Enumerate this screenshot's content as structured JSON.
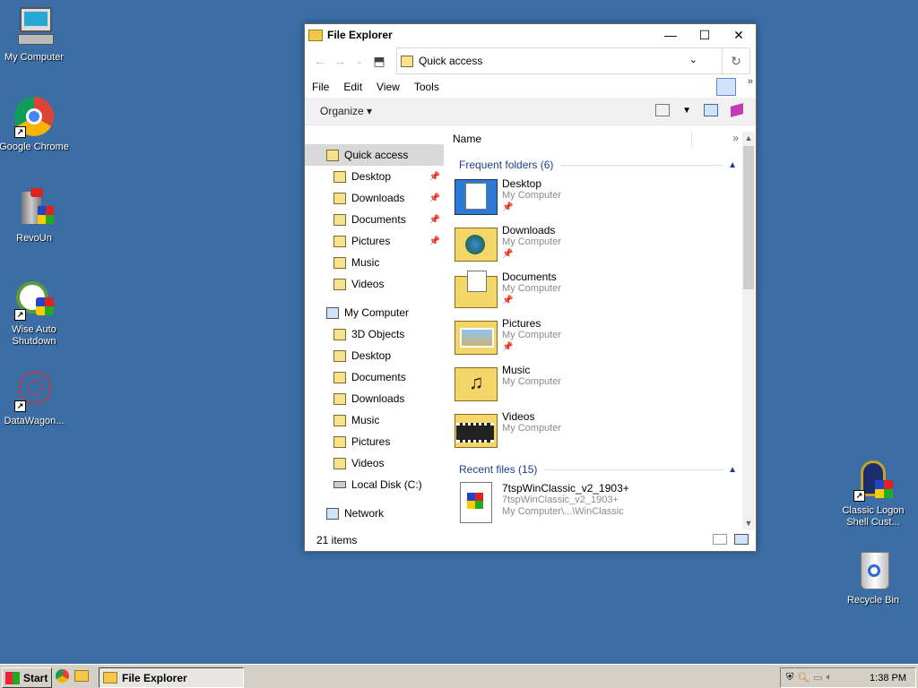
{
  "desktop": {
    "icons": [
      {
        "label": "My Computer",
        "icon": "computer-icon"
      },
      {
        "label": "Google Chrome",
        "icon": "chrome-icon"
      },
      {
        "label": "RevoUn",
        "icon": "revo-uninstaller-icon"
      },
      {
        "label": "Wise Auto Shutdown",
        "icon": "alarm-clock-icon"
      },
      {
        "label": "DataWagon...",
        "icon": "datawagon-icon"
      },
      {
        "label": "Classic Logon Shell Cust...",
        "icon": "logon-shell-icon"
      },
      {
        "label": "Recycle Bin",
        "icon": "recycle-bin-icon"
      }
    ]
  },
  "window": {
    "title": "File Explorer",
    "address": "Quick access",
    "menu": [
      "File",
      "Edit",
      "View",
      "Tools"
    ],
    "organize_label": "Organize",
    "column_name": "Name",
    "status": "21 items"
  },
  "navpane": {
    "quick_access": "Quick access",
    "quick_items": [
      "Desktop",
      "Downloads",
      "Documents",
      "Pictures",
      "Music",
      "Videos"
    ],
    "my_computer": "My Computer",
    "computer_items": [
      "3D Objects",
      "Desktop",
      "Documents",
      "Downloads",
      "Music",
      "Pictures",
      "Videos",
      "Local Disk (C:)"
    ],
    "network": "Network"
  },
  "content": {
    "frequent_header": "Frequent folders (6)",
    "folders": [
      {
        "name": "Desktop",
        "location": "My Computer"
      },
      {
        "name": "Downloads",
        "location": "My Computer"
      },
      {
        "name": "Documents",
        "location": "My Computer"
      },
      {
        "name": "Pictures",
        "location": "My Computer"
      },
      {
        "name": "Music",
        "location": "My Computer"
      },
      {
        "name": "Videos",
        "location": "My Computer"
      }
    ],
    "recent_header": "Recent files (15)",
    "recent": [
      {
        "name": "7tspWinClassic_v2_1903+",
        "sub": "7tspWinClassic_v2_1903+",
        "path": "My Computer\\...\\WinClassic"
      }
    ]
  },
  "taskbar": {
    "start": "Start",
    "task": "File Explorer",
    "clock": "1:38 PM"
  },
  "colors": {
    "desktop": "#3a6ea5",
    "taskbar": "#d4d0c8",
    "group_header": "#1e3d8c"
  }
}
